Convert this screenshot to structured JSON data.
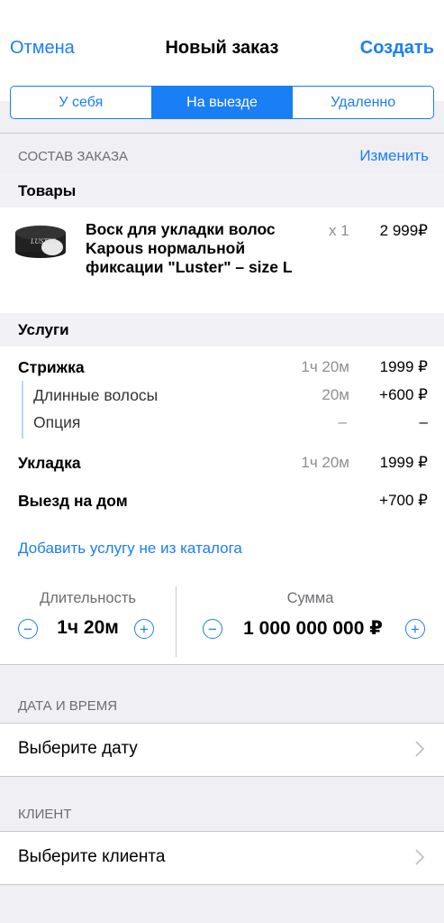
{
  "nav": {
    "cancel": "Отмена",
    "title": "Новый заказ",
    "create": "Создать"
  },
  "segments": [
    "У себя",
    "На выезде",
    "Удаленно"
  ],
  "active_segment": "На выезде",
  "order": {
    "header": "СОСТАВ ЗАКАЗА",
    "edit": "Изменить",
    "goods_title": "Товары",
    "product": {
      "name": "Воск для укладки волос Kapous нормальной фиксации \"Luster\" – size L",
      "qty": "x 1",
      "price": "2 999₽",
      "image_label": "LUSTER"
    },
    "services_title": "Услуги",
    "services": [
      {
        "name": "Стрижка",
        "duration": "1ч 20м",
        "price": "1999 ₽"
      },
      {
        "name": "Длинные волосы",
        "duration": "20м",
        "price": "+600 ₽"
      },
      {
        "name": "Опция",
        "duration": "–",
        "price": "–"
      },
      {
        "name": "Укладка",
        "duration": "1ч 20м",
        "price": "1999 ₽"
      },
      {
        "name": "Выезд на дом",
        "duration": "",
        "price": "+700 ₽"
      }
    ],
    "add_service": "Добавить услугу не из каталога"
  },
  "totals": {
    "duration_label": "Длительность",
    "duration_value": "1ч 20м",
    "sum_label": "Сумма",
    "sum_value": "1 000 000 000 ₽",
    "minus": "−",
    "plus": "+"
  },
  "datetime": {
    "header": "ДАТА И ВРЕМЯ",
    "placeholder": "Выберите дату"
  },
  "client": {
    "header": "КЛИЕНТ",
    "placeholder": "Выберите клиента"
  },
  "colors": {
    "accent": "#1a7ef5",
    "background": "#efeff4",
    "secondary_text": "#8e8e93"
  }
}
